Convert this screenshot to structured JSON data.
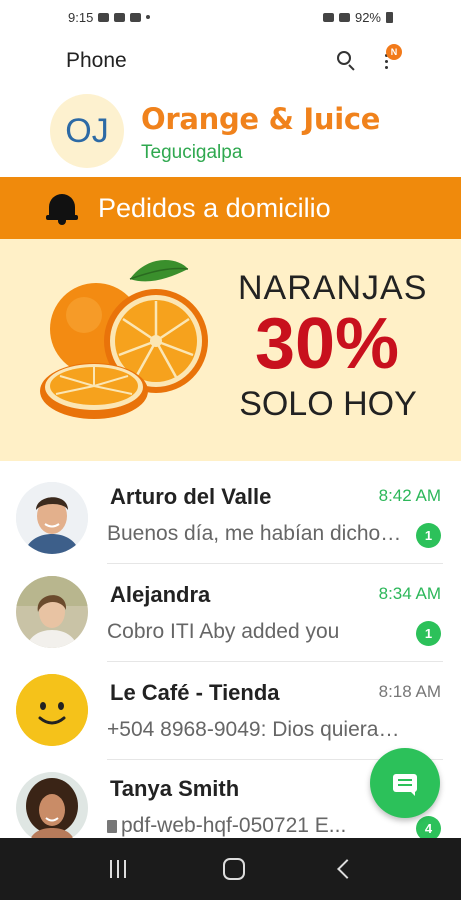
{
  "status_bar": {
    "time": "9:15",
    "battery": "92%"
  },
  "app_bar": {
    "title": "Phone",
    "notification_badge": "N"
  },
  "brand": {
    "logo_text": "OJ",
    "name": "Orange & Juice",
    "city": "Tegucigalpa",
    "name_color": "#f0821c",
    "city_color": "#2fa84f"
  },
  "delivery_banner": {
    "text": "Pedidos a domicilio",
    "color": "#f08a0c"
  },
  "promo": {
    "line1": "NARANJAS",
    "line2": "30%",
    "line3": "SOLO HOY",
    "accent": "#c8101d",
    "background": "#fff0c7"
  },
  "chats": [
    {
      "name": "Arturo del Valle",
      "time": "8:42 AM",
      "preview": "Buenos día, me habían dicho que...",
      "unread": "1",
      "avatar": "young-man-avatar"
    },
    {
      "name": "Alejandra",
      "time": "8:34 AM",
      "preview": "Cobro ITI Aby added you",
      "unread": "1",
      "avatar": "woman-outdoor-avatar"
    },
    {
      "name": "Le Café - Tienda",
      "time": "8:18 AM",
      "preview": "+504 8968-9049: Dios quiera que...",
      "unread": "",
      "avatar": "smiley-face-avatar"
    },
    {
      "name": "Tanya Smith",
      "time": "",
      "preview": "pdf-web-hqf-050721 E...",
      "unread": "4",
      "avatar": "woman-curly-hair-avatar"
    }
  ],
  "colors": {
    "unread_green": "#2cc15a"
  },
  "fab": {
    "icon": "chat-icon"
  }
}
